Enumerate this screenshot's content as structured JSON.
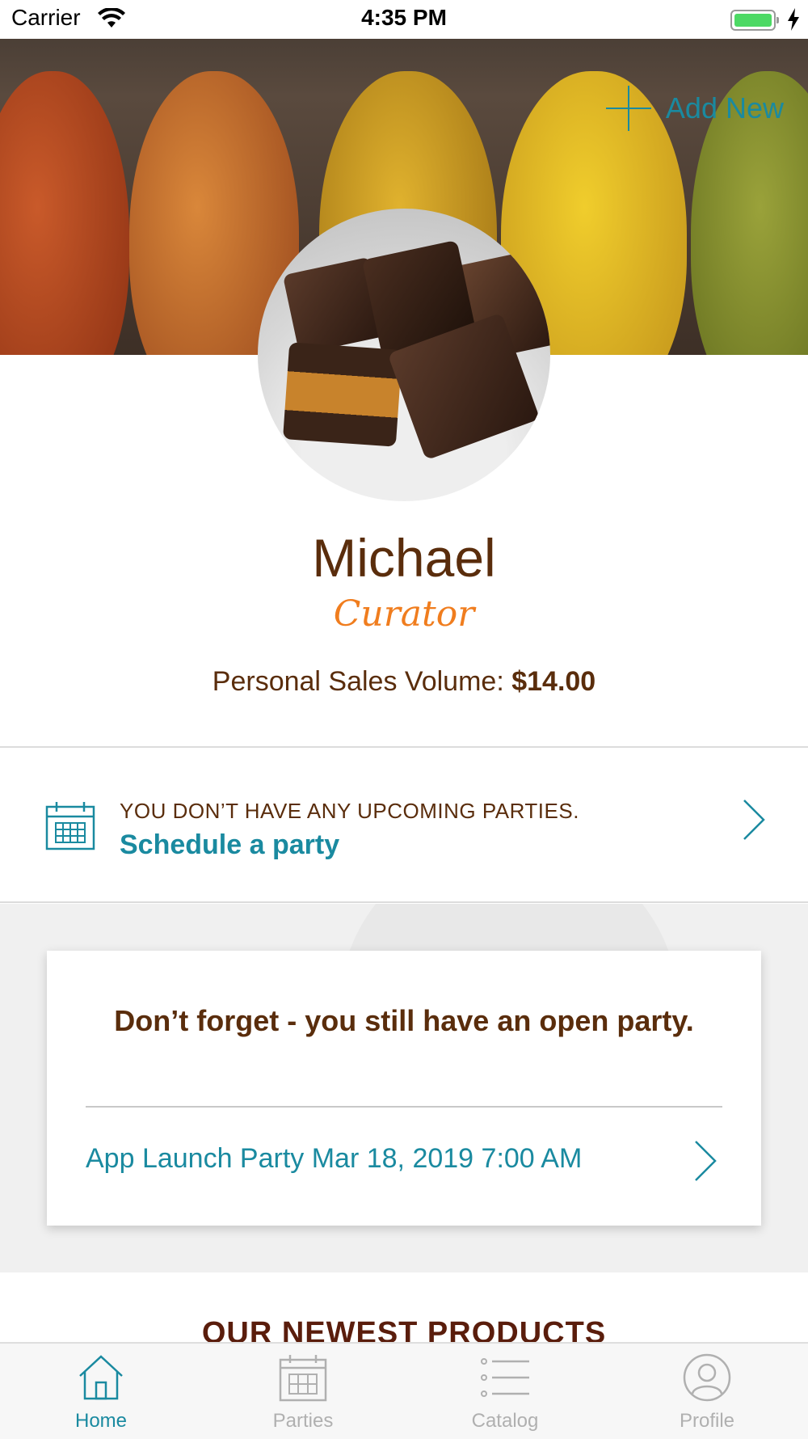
{
  "status_bar": {
    "carrier": "Carrier",
    "time": "4:35 PM"
  },
  "header": {
    "add_new_label": "Add New"
  },
  "profile": {
    "name": "Michael",
    "title": "Curator",
    "sales_label": "Personal Sales Volume:",
    "sales_value": "$14.00"
  },
  "upcoming": {
    "message": "YOU DON’T HAVE ANY UPCOMING PARTIES.",
    "link": "Schedule a party"
  },
  "reminder": {
    "heading": "Don’t forget - you still have an open party.",
    "party": "App Launch Party Mar 18, 2019 7:00 AM"
  },
  "products": {
    "heading": "OUR NEWEST PRODUCTS"
  },
  "tabs": [
    {
      "label": "Home",
      "icon": "home-icon"
    },
    {
      "label": "Parties",
      "icon": "calendar-icon"
    },
    {
      "label": "Catalog",
      "icon": "list-icon"
    },
    {
      "label": "Profile",
      "icon": "user-icon"
    }
  ],
  "colors": {
    "accent": "#1a8aa0",
    "brown": "#5a2d0c",
    "orange": "#f07d1e"
  }
}
